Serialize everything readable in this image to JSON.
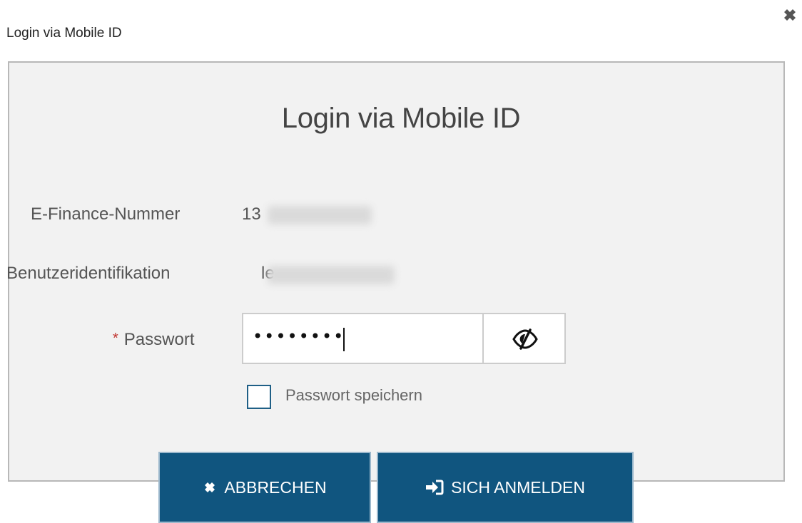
{
  "dialog": {
    "title": "Login via Mobile ID",
    "close_icon": "close-icon"
  },
  "form": {
    "heading": "Login via Mobile ID",
    "finance_number": {
      "label": "E-Finance-Nummer",
      "value_visible": "13"
    },
    "user_id": {
      "label": "Benutzeridentifikation",
      "value_visible": "le"
    },
    "password": {
      "label": "Passwort",
      "required_marker": "*",
      "masked_value": "••••••••",
      "toggle_icon": "eye-slash-icon"
    },
    "remember": {
      "label": "Passwort speichern",
      "checked": false
    }
  },
  "buttons": {
    "cancel": {
      "label": "ABBRECHEN",
      "icon": "close-icon"
    },
    "login": {
      "label": "SICH ANMELDEN",
      "icon": "sign-in-icon"
    }
  },
  "colors": {
    "primary": "#10557f",
    "required": "#c0322d",
    "panel_bg": "#f2f2f2"
  }
}
